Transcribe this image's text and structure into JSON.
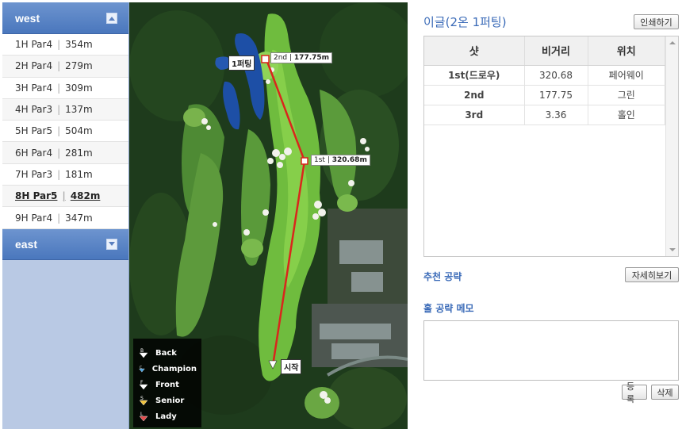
{
  "sidebar": {
    "sections": [
      {
        "title": "west",
        "toggle": "collapse"
      },
      {
        "title": "east",
        "toggle": "expand"
      }
    ],
    "holes": [
      {
        "hole": "1H Par4",
        "dist": "354m"
      },
      {
        "hole": "2H Par4",
        "dist": "279m"
      },
      {
        "hole": "3H Par4",
        "dist": "309m"
      },
      {
        "hole": "4H Par3",
        "dist": "137m"
      },
      {
        "hole": "5H Par5",
        "dist": "504m"
      },
      {
        "hole": "6H Par4",
        "dist": "281m"
      },
      {
        "hole": "7H Par3",
        "dist": "181m"
      },
      {
        "hole": "8H Par5",
        "dist": "482m"
      },
      {
        "hole": "9H Par4",
        "dist": "347m"
      }
    ],
    "active_index": 7
  },
  "map": {
    "markers": {
      "putt": "1퍼팅",
      "second_num": "2nd",
      "second_dist": "177.75m",
      "first_num": "1st",
      "first_dist": "320.68m",
      "start": "시작"
    },
    "legend": [
      {
        "label": "Back",
        "letter": "B",
        "color": "#ffffff"
      },
      {
        "label": "Champion",
        "letter": "C",
        "color": "#4aa3e0"
      },
      {
        "label": "Front",
        "letter": "F",
        "color": "#ffffff"
      },
      {
        "label": "Senior",
        "letter": "S",
        "color": "#f2c43c"
      },
      {
        "label": "Lady",
        "letter": "L",
        "color": "#e74b4b"
      }
    ]
  },
  "panel": {
    "title": "이글(2온 1퍼팅)",
    "print_button": "인쇄하기",
    "table": {
      "headers": [
        "샷",
        "비거리",
        "위치"
      ],
      "rows": [
        [
          "1st(드로우)",
          "320.68",
          "페어웨이"
        ],
        [
          "2nd",
          "177.75",
          "그린"
        ],
        [
          "3rd",
          "3.36",
          "홀인"
        ]
      ]
    },
    "strategy_label": "추천 공략",
    "detail_button": "자세히보기",
    "memo_label": "홀 공략 메모",
    "memo_value": "",
    "register_button": "등록",
    "delete_button": "삭제"
  },
  "colors": {
    "accent": "#3b6bb8",
    "sidebar_header": "#5a84c6",
    "route_line": "#d9261c"
  }
}
